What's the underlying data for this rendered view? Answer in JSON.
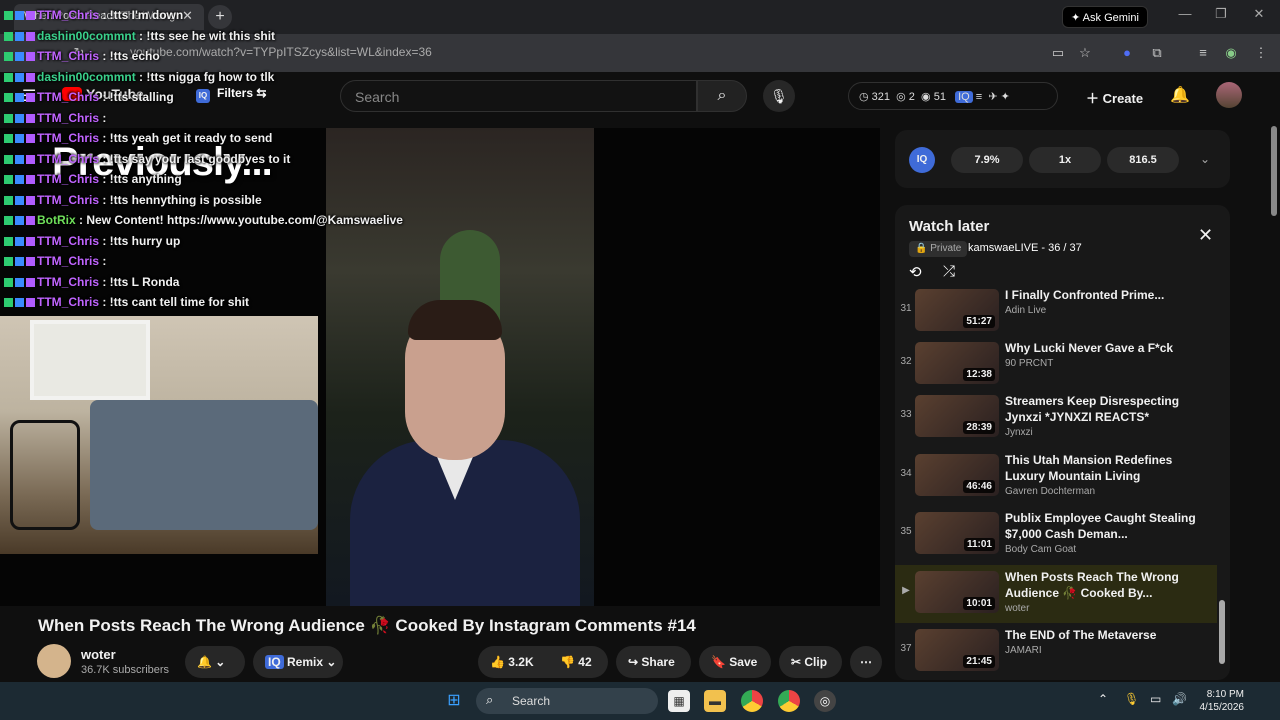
{
  "browser": {
    "tab_title": "When Posts Reach The Wrong",
    "url": "youtube.com/watch?v=TYPpITSZcys&list=WL&index=36",
    "gemini_label": "Ask Gemini"
  },
  "yt": {
    "logo_text": "YouTube",
    "filters_label": "Filters",
    "search_placeholder": "Search",
    "stats": {
      "views": "321",
      "users": "2",
      "eye": "51"
    },
    "create_label": "Create"
  },
  "chat": [
    {
      "user": "TTM_Chris",
      "msg": " : !tts I'm down",
      "color": "#c064ff"
    },
    {
      "user": "dashin00commnt",
      "msg": " : !tts see he wit this shit",
      "color": "#3ad18c"
    },
    {
      "user": "TTM_Chris",
      "msg": " : !tts echo",
      "color": "#c064ff"
    },
    {
      "user": "dashin00commnt",
      "msg": " : !tts nigga fg how to tlk",
      "color": "#3ad18c"
    },
    {
      "user": "TTM_Chris",
      "msg": " : !tts stalling",
      "color": "#c064ff"
    },
    {
      "user": "TTM_Chris",
      "msg": " : ",
      "color": "#c064ff"
    },
    {
      "user": "TTM_Chris",
      "msg": " : !tts yeah get it ready to send",
      "color": "#c064ff"
    },
    {
      "user": "TTM_Chris",
      "msg": " : !tts say your last goodbyes to it",
      "color": "#c064ff"
    },
    {
      "user": "TTM_Chris",
      "msg": " : !tts anything",
      "color": "#c064ff"
    },
    {
      "user": "TTM_Chris",
      "msg": " : !tts hennything is possible",
      "color": "#c064ff"
    },
    {
      "user": "BotRix",
      "msg": " : New Content! https://www.youtube.com/@Kamswaelive",
      "color": "#6fe05a"
    },
    {
      "user": "TTM_Chris",
      "msg": " : !tts hurry up",
      "color": "#c064ff"
    },
    {
      "user": "TTM_Chris",
      "msg": " : ",
      "color": "#c064ff"
    },
    {
      "user": "TTM_Chris",
      "msg": " : !tts L Ronda",
      "color": "#c064ff"
    },
    {
      "user": "TTM_Chris",
      "msg": " : !tts cant tell time for shit",
      "color": "#c064ff"
    }
  ],
  "video": {
    "overlay_text": "Previously...",
    "title": "When Posts Reach The Wrong Audience 🥀 Cooked By Instagram Comments #14",
    "channel": "woter",
    "subscribers": "36.7K subscribers",
    "remix_label": "Remix",
    "likes": "3.2K",
    "dislikes": "42",
    "share_label": "Share",
    "save_label": "Save",
    "clip_label": "Clip"
  },
  "extension": {
    "logo": "IQ",
    "percent": "7.9%",
    "speed": "1x",
    "value": "816.5"
  },
  "watch_later": {
    "title": "Watch later",
    "privacy": "Private",
    "owner": "kamswaeLIVE - 36 / 37",
    "items": [
      {
        "num": "31",
        "title": "I Finally Confronted Prime...",
        "channel": "Adin Live",
        "duration": "51:27"
      },
      {
        "num": "32",
        "title": "Why Lucki Never Gave a F*ck",
        "channel": "90 PRCNT",
        "duration": "12:38"
      },
      {
        "num": "33",
        "title": "Streamers Keep Disrespecting Jynxzi *JYNXZI REACTS*",
        "channel": "Jynxzi",
        "duration": "28:39"
      },
      {
        "num": "34",
        "title": "This Utah Mansion Redefines Luxury Mountain Living",
        "channel": "Gavren Dochterman",
        "duration": "46:46"
      },
      {
        "num": "35",
        "title": "Publix Employee Caught Stealing $7,000 Cash Deman...",
        "channel": "Body Cam Goat",
        "duration": "11:01"
      },
      {
        "num": "▶",
        "title": "When Posts Reach The Wrong Audience 🥀 Cooked By...",
        "channel": "woter",
        "duration": "10:01"
      },
      {
        "num": "37",
        "title": "The END of The Metaverse",
        "channel": "JAMARI",
        "duration": "21:45"
      }
    ]
  },
  "taskbar": {
    "search_label": "Search",
    "time": "8:10 PM",
    "date": "4/15/2026"
  }
}
